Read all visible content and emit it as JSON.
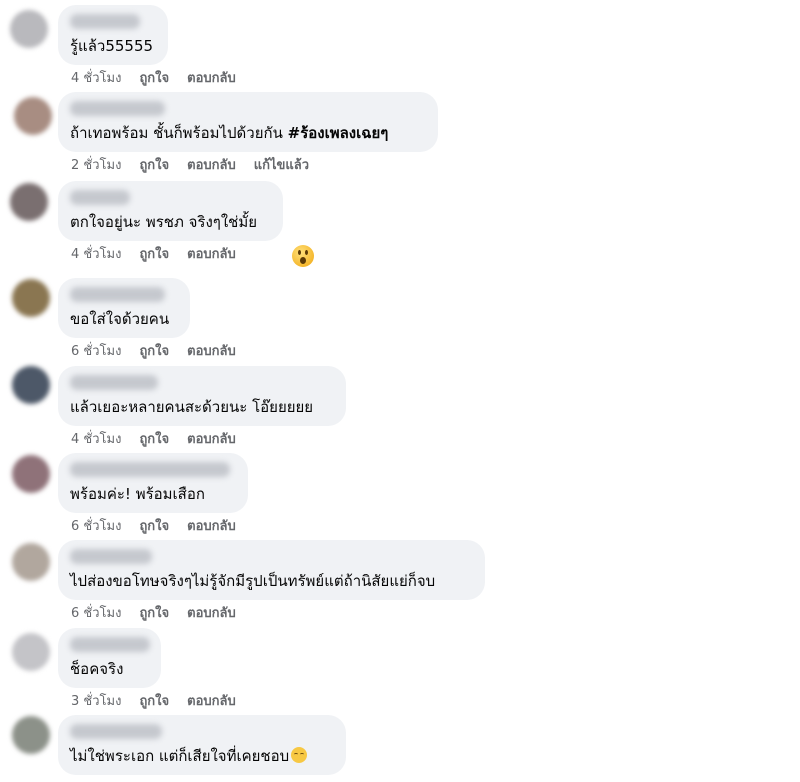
{
  "comments": [
    {
      "text": "รู้แล้ว55555",
      "time": "4 ชั่วโมง",
      "like": "ถูกใจ",
      "reply": "ตอบกลับ",
      "avatar_color": "#b9b9bd"
    },
    {
      "text": "ถ้าเทอพร้อม ชั้นก็พร้อมไปด้วยกัน ",
      "hashtag": "#ร้องเพลงเฉยๆ",
      "time": "2 ชั่วโมง",
      "like": "ถูกใจ",
      "reply": "ตอบกลับ",
      "edited": "แก้ไขแล้ว",
      "avatar_color": "#a88d82"
    },
    {
      "text": "ตกใจอยู่นะ พรชภ จริงๆใช่มั้ย",
      "time": "4 ชั่วโมง",
      "like": "ถูกใจ",
      "reply": "ตอบกลับ",
      "avatar_color": "#7a6f70",
      "reaction_icon": "surprised-face-emoji"
    },
    {
      "text": "ขอใส่ใจด้วยคน",
      "time": "6 ชั่วโมง",
      "like": "ถูกใจ",
      "reply": "ตอบกลับ",
      "avatar_color": "#8a7651"
    },
    {
      "text": "แล้วเยอะหลายคนสะด้วยนะ โอ๊ยยยยย",
      "time": "4 ชั่วโมง",
      "like": "ถูกใจ",
      "reply": "ตอบกลับ",
      "avatar_color": "#4d5868"
    },
    {
      "text": "พร้อมค่ะ! พร้อมเสือก",
      "time": "6 ชั่วโมง",
      "like": "ถูกใจ",
      "reply": "ตอบกลับ",
      "avatar_color": "#8f7279"
    },
    {
      "text": "ไปส่องขอโทษจริงๆไม่รู้จักมีรูปเป็นทรัพย์แต่ถ้านิสัยแย่ก็จบ",
      "time": "6 ชั่วโมง",
      "like": "ถูกใจ",
      "reply": "ตอบกลับ",
      "avatar_color": "#b1a79e"
    },
    {
      "text": "ช็อคจริง",
      "time": "3 ชั่วโมง",
      "like": "ถูกใจ",
      "reply": "ตอบกลับ",
      "avatar_color": "#c4c4c8"
    },
    {
      "text": "ไม่ใช่พระเอก แต่ก็เสียใจที่เคยชอบ",
      "emoji": "pensive-face-emoji",
      "time": "",
      "like": "",
      "reply": "",
      "avatar_color": "#8c9189"
    }
  ]
}
